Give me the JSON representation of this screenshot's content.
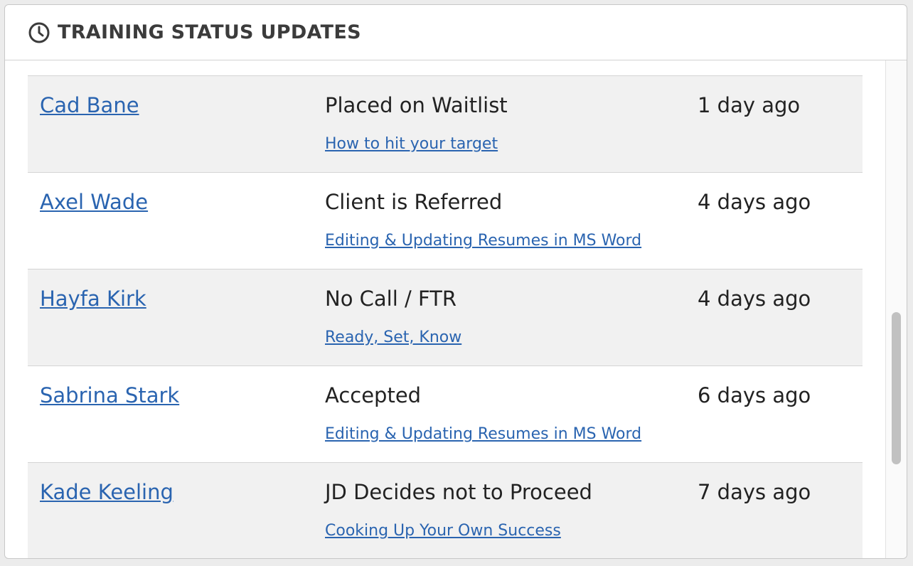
{
  "panel": {
    "title": "TRAINING STATUS UPDATES",
    "icon": "clock-icon"
  },
  "updates": [
    {
      "name": "Cad Bane",
      "status": "Placed on Waitlist",
      "course": "How to hit your target",
      "time": "1 day ago"
    },
    {
      "name": "Axel Wade",
      "status": "Client is Referred",
      "course": "Editing & Updating Resumes in MS Word",
      "time": "4 days ago"
    },
    {
      "name": "Hayfa Kirk",
      "status": "No Call / FTR",
      "course": "Ready, Set, Know",
      "time": "4 days ago"
    },
    {
      "name": "Sabrina Stark",
      "status": "Accepted",
      "course": "Editing & Updating Resumes in MS Word",
      "time": "6 days ago"
    },
    {
      "name": "Kade Keeling",
      "status": "JD Decides not to Proceed",
      "course": "Cooking Up Your Own Success",
      "time": "7 days ago"
    }
  ],
  "colors": {
    "link": "#2a64b0",
    "row_shaded": "#f1f1f1",
    "title": "#3b3b3b"
  }
}
